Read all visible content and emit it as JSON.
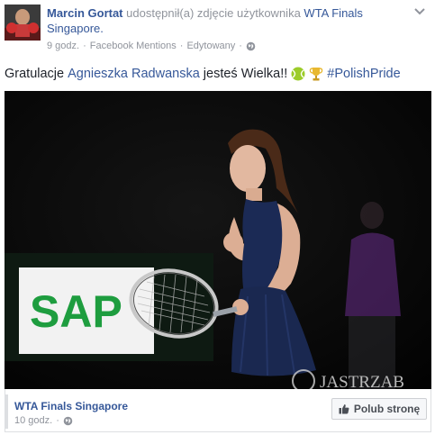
{
  "post": {
    "author": "Marcin Gortat",
    "action_text": "udostępnił(a) zdjęcie użytkownika",
    "shared_from": "WTA Finals Singapore.",
    "time": "9 godz.",
    "separator": "·",
    "source": "Facebook Mentions",
    "edited": "Edytowany",
    "message_prefix": "Gratulacje",
    "message_name": "Agnieszka Radwanska",
    "message_suffix": "jesteś Wielka!!",
    "hashtag": "#PolishPride",
    "emoji": [
      "tennis-ball-icon",
      "trophy-icon"
    ]
  },
  "photo": {
    "sponsor_logo": "SAP",
    "watermark": "JASTRZAB"
  },
  "shared_card": {
    "page_name": "WTA Finals Singapore",
    "time": "10 godz.",
    "separator": "·",
    "like_button_label": "Polub stronę"
  },
  "colors": {
    "link": "#365899",
    "muted": "#90949c",
    "text": "#1d2129",
    "dress": "#1b2a55",
    "sap_green": "#1e9d3f"
  }
}
